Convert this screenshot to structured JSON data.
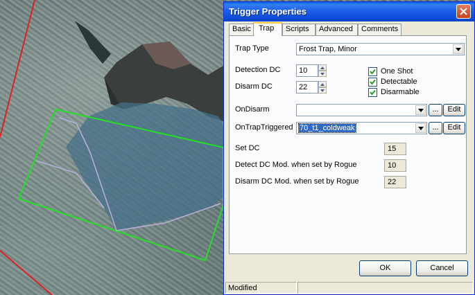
{
  "dialog": {
    "title": "Trigger Properties",
    "tabs": [
      {
        "label": "Basic",
        "active": false
      },
      {
        "label": "Trap",
        "active": true
      },
      {
        "label": "Scripts",
        "active": false
      },
      {
        "label": "Advanced",
        "active": false
      },
      {
        "label": "Comments",
        "active": false
      }
    ]
  },
  "trap": {
    "trap_type_label": "Trap Type",
    "trap_type_value": "Frost Trap, Minor",
    "detection_dc_label": "Detection DC",
    "detection_dc_value": "10",
    "disarm_dc_label": "Disarm DC",
    "disarm_dc_value": "22",
    "checkboxes": [
      {
        "label": "One Shot",
        "checked": true
      },
      {
        "label": "Detectable",
        "checked": true
      },
      {
        "label": "Disarmable",
        "checked": true
      }
    ],
    "on_disarm_label": "OnDisarm",
    "on_disarm_value": "",
    "on_trap_triggered_label": "OnTrapTriggered",
    "on_trap_triggered_value": "70_t1_coldweak",
    "browse_label": "...",
    "edit_label": "Edit",
    "set_dc_label": "Set DC",
    "set_dc_value": "15",
    "detect_dc_mod_label": "Detect DC Mod. when set by Rogue",
    "detect_dc_mod_value": "10",
    "disarm_dc_mod_label": "Disarm DC Mod. when set by Rogue",
    "disarm_dc_mod_value": "22"
  },
  "buttons": {
    "ok": "OK",
    "cancel": "Cancel"
  },
  "status": {
    "text": "Modified"
  },
  "colors": {
    "titlebar": "#0a49d4",
    "dialog_bg": "#ece9d8",
    "selection": "#316ac5",
    "trigger_outline_selected": "#22e022",
    "trigger_outline_other": "#e02020"
  }
}
